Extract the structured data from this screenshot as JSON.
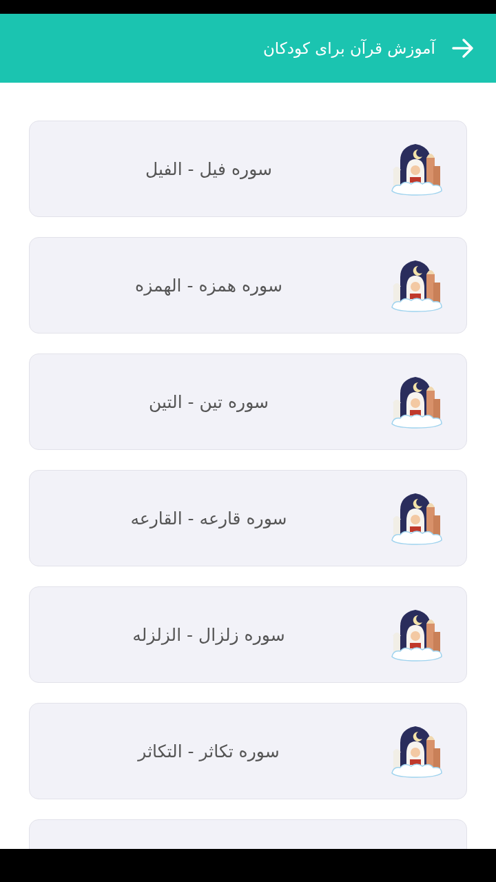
{
  "header": {
    "title": "آموزش قرآن برای کودکان"
  },
  "items": [
    {
      "title": "سوره فیل - الفیل"
    },
    {
      "title": "سوره همزه - الهمزه"
    },
    {
      "title": "سوره تین - التین"
    },
    {
      "title": "سوره قارعه - القارعه"
    },
    {
      "title": "سوره زلزال - الزلزله"
    },
    {
      "title": "سوره تکاثر - التکاثر"
    }
  ]
}
